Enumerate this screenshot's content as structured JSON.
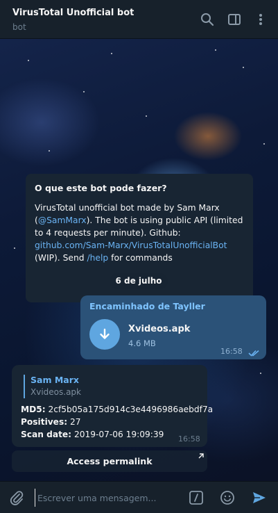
{
  "header": {
    "title": "VirusTotal Unofficial bot",
    "subtitle": "bot",
    "icons": [
      "search-icon",
      "sidebar-toggle-icon",
      "more-vertical-icon"
    ]
  },
  "bot_info": {
    "title": "O que este bot pode fazer?",
    "text_1": "VirusTotal unofficial bot made by Sam Marx (",
    "mention": "@SamMarx",
    "text_2": "). The bot is using public API (limited to 4 requests per minute). Github: ",
    "github_link": "github.com/Sam-Marx/VirusTotalUnofficialBot",
    "text_3": " (WIP). Send ",
    "command": "/help",
    "text_4": " for commands"
  },
  "date_separator": "6 de julho",
  "outgoing_message": {
    "forwarded_from": "Encaminhado de Tayller",
    "file_name": "Xvideos.apk",
    "file_size": "4.6 MB",
    "time": "16:58",
    "status": "read"
  },
  "incoming_message": {
    "reply_name": "Sam Marx",
    "reply_text": "Xvideos.apk",
    "md5_label": "MD5:",
    "md5_value": "2cf5b05a175d914c3e4496986aebdf7a",
    "positives_label": "Positives:",
    "positives_value": "27",
    "scan_date_label": "Scan date:",
    "scan_date_value": "2019-07-06 19:09:39",
    "time": "16:58"
  },
  "inline_button": {
    "label": "Access permalink"
  },
  "composer": {
    "placeholder": "Escrever uma mensagem..."
  },
  "colors": {
    "header_bg": "#17212b",
    "bubble_in": "#182533",
    "bubble_out": "#2b5278",
    "link": "#6ab3f3",
    "accent": "#5fa6e0"
  }
}
